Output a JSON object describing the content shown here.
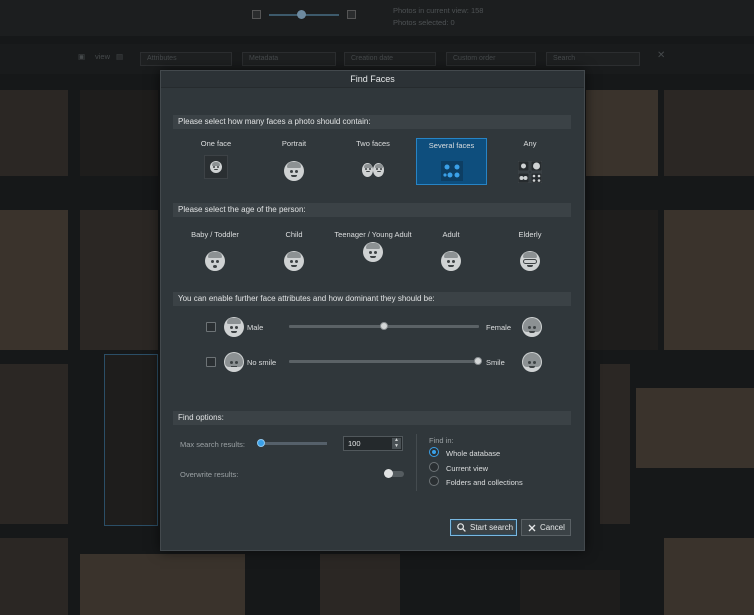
{
  "background": {
    "photos_in_current_view": "Photos in current view: 158",
    "photos_selected": "Photos selected: 0",
    "view_label": "view",
    "toolbar": [
      "Attributes",
      "Metadata",
      "Creation date",
      "Custom order",
      "Search"
    ]
  },
  "dialog": {
    "title": "Find Faces",
    "faces_section": "Please select how many faces a photo should contain:",
    "face_options": [
      {
        "label": "One face",
        "selected": false
      },
      {
        "label": "Portrait",
        "selected": false
      },
      {
        "label": "Two faces",
        "selected": false
      },
      {
        "label": "Several faces",
        "selected": true
      },
      {
        "label": "Any",
        "selected": false
      }
    ],
    "age_section": "Please select the age of the person:",
    "age_options": [
      {
        "label": "Baby / Toddler"
      },
      {
        "label": "Child"
      },
      {
        "label": "Teenager / Young Adult"
      },
      {
        "label": "Adult"
      },
      {
        "label": "Elderly"
      }
    ],
    "attributes_section": "You can enable further face attributes and how dominant they should be:",
    "attributes": [
      {
        "left": "Male",
        "right": "Female",
        "enabled": false,
        "value": 0.5
      },
      {
        "left": "No smile",
        "right": "Smile",
        "enabled": false,
        "value": 1.0
      }
    ],
    "find_options_section": "Find options:",
    "max_results_label": "Max search results:",
    "max_results_value": "100",
    "max_results_slider": 0.0,
    "overwrite_label": "Overwrite results:",
    "overwrite_enabled": false,
    "find_in_label": "Find in:",
    "find_in_options": [
      {
        "label": "Whole database",
        "selected": true
      },
      {
        "label": "Current view",
        "selected": false
      },
      {
        "label": "Folders and collections",
        "selected": false
      }
    ],
    "start_button": "Start search",
    "cancel_button": "Cancel"
  },
  "colors": {
    "accent": "#3aa0e8",
    "selected_option_bg": "#0e4e7d",
    "dialog_bg": "#30373b"
  }
}
